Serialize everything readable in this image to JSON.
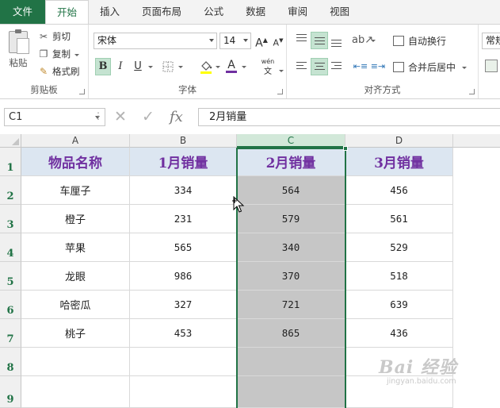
{
  "ribbon": {
    "tabs": [
      "文件",
      "开始",
      "插入",
      "页面布局",
      "公式",
      "数据",
      "审阅",
      "视图"
    ],
    "active_tab": "开始",
    "clipboard": {
      "paste": "粘贴",
      "cut": "剪切",
      "copy": "复制",
      "format_painter": "格式刷",
      "label": "剪贴板"
    },
    "font": {
      "name": "宋体",
      "size": "14",
      "grow": "A",
      "shrink": "A",
      "bold": "B",
      "italic": "I",
      "underline": "U",
      "font_color_glyph": "A",
      "phonetic_top": "wén",
      "phonetic_bottom": "文",
      "label": "字体"
    },
    "alignment": {
      "wrap_text": "自动换行",
      "merge_center": "合并后居中",
      "label": "对齐方式"
    },
    "number": {
      "format": "常规"
    }
  },
  "formula_bar": {
    "name_box": "C1",
    "dots": "⋮",
    "cancel": "✕",
    "enter": "✓",
    "fx": "fx",
    "content": "2月销量"
  },
  "sheet": {
    "columns": [
      "A",
      "B",
      "C",
      "D"
    ],
    "selected_column": "C",
    "rows": [
      "1",
      "2",
      "3",
      "4",
      "5",
      "6",
      "7",
      "8",
      "9"
    ],
    "header": [
      "物品名称",
      "1月销量",
      "2月销量",
      "3月销量"
    ],
    "data": [
      [
        "车厘子",
        "334",
        "564",
        "456"
      ],
      [
        "橙子",
        "231",
        "579",
        "561"
      ],
      [
        "苹果",
        "565",
        "340",
        "529"
      ],
      [
        "龙眼",
        "986",
        "370",
        "518"
      ],
      [
        "哈密瓜",
        "327",
        "721",
        "639"
      ],
      [
        "桃子",
        "453",
        "865",
        "436"
      ]
    ]
  },
  "colors": {
    "accent": "#217346",
    "header_fill": "#dce6f1",
    "header_text": "#7030a0",
    "selection_fill": "#c6c6c6"
  },
  "watermark": {
    "main": "Bai 经验",
    "sub": "jingyan.baidu.com"
  }
}
